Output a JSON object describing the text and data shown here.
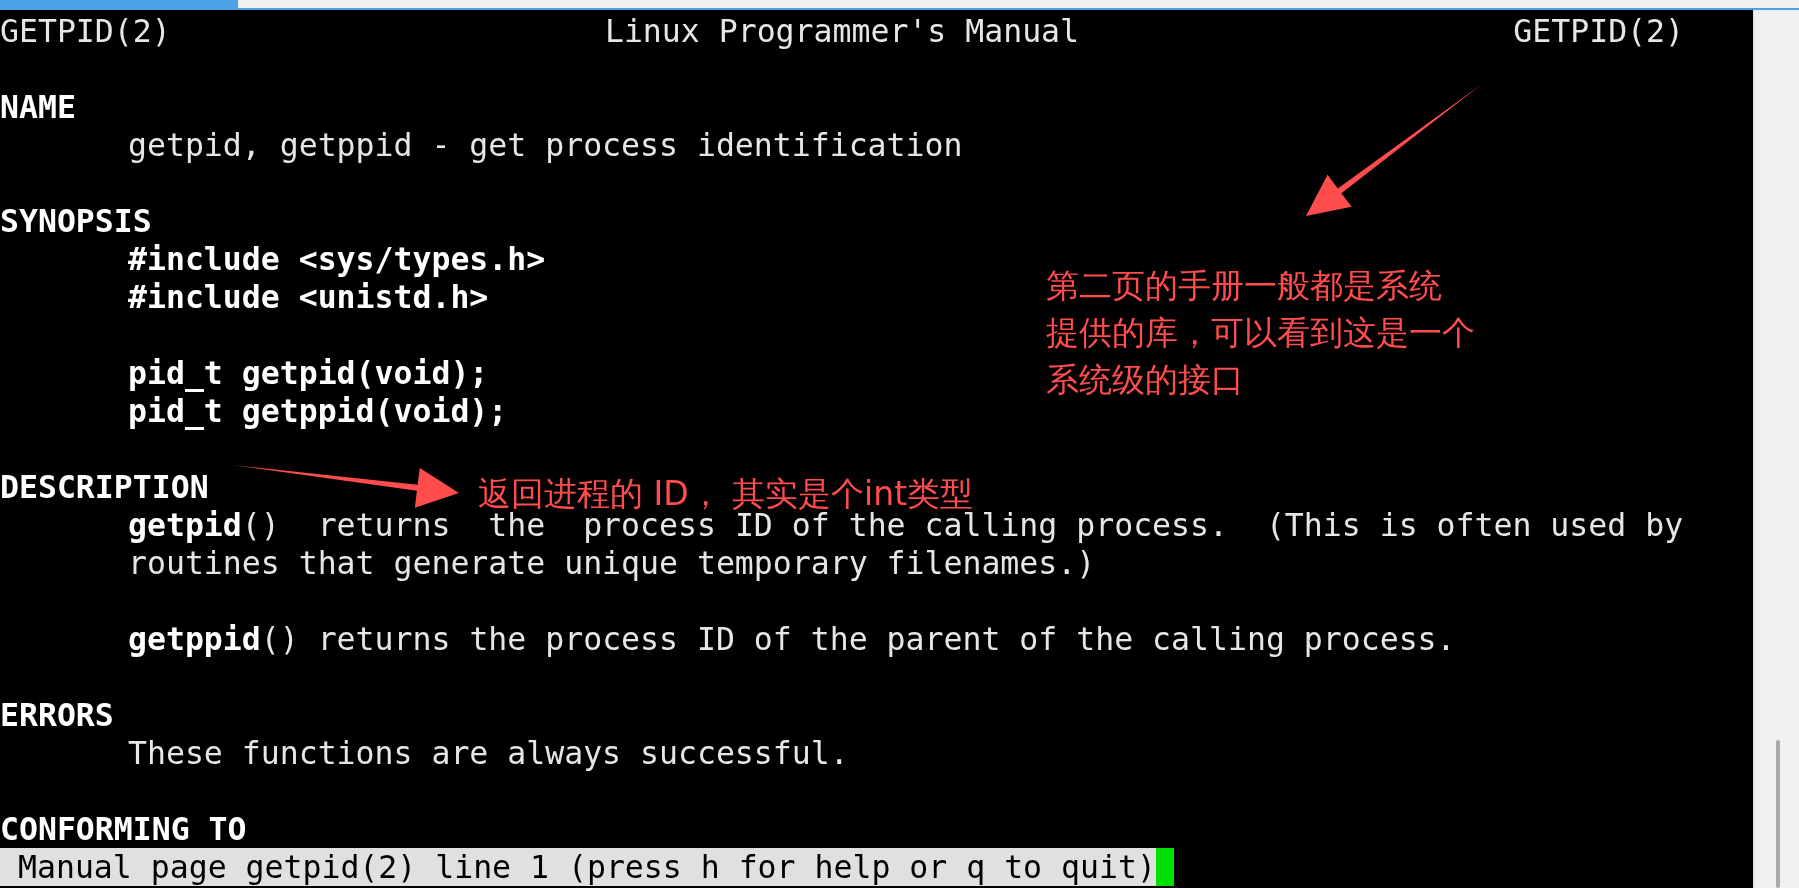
{
  "header": {
    "left": "GETPID(2)",
    "center": "Linux Programmer's Manual",
    "right": "GETPID(2)"
  },
  "sections": [
    {
      "heading": "NAME",
      "paragraphs": [
        [
          {
            "text": "getpid, getppid - get process identification",
            "bold": false
          }
        ]
      ]
    },
    {
      "heading": "SYNOPSIS",
      "paragraphs": [
        [
          {
            "text": "#include <sys/types.h>",
            "bold": true
          },
          {
            "text": "#include <unistd.h>",
            "bold": true
          }
        ],
        [
          {
            "text": "pid_t getpid(void);",
            "bold": true
          },
          {
            "text": "pid_t getppid(void);",
            "bold": true
          }
        ]
      ]
    },
    {
      "heading": "DESCRIPTION",
      "paragraphs": [
        [
          {
            "text": "**getpid**()  returns  the  process ID of the calling process.  (This is often used by",
            "bold": false
          },
          {
            "text": "routines that generate unique temporary filenames.)",
            "bold": false
          }
        ],
        [
          {
            "text": "**getppid**() returns the process ID of the parent of the calling process.",
            "bold": false
          }
        ]
      ]
    },
    {
      "heading": "ERRORS",
      "paragraphs": [
        [
          {
            "text": "These functions are always successful.",
            "bold": false
          }
        ]
      ]
    },
    {
      "heading": "CONFORMING TO"
    }
  ],
  "status_line": "Manual page getpid(2) line 1 (press h for help or q to quit)",
  "annotations": [
    {
      "lines": [
        "第二页的手册一般都是系统",
        "提供的库，可以看到这是一个",
        "系统级的接口"
      ]
    },
    {
      "lines": [
        "返回进程的 ID， 其实是个int类型"
      ]
    }
  ]
}
